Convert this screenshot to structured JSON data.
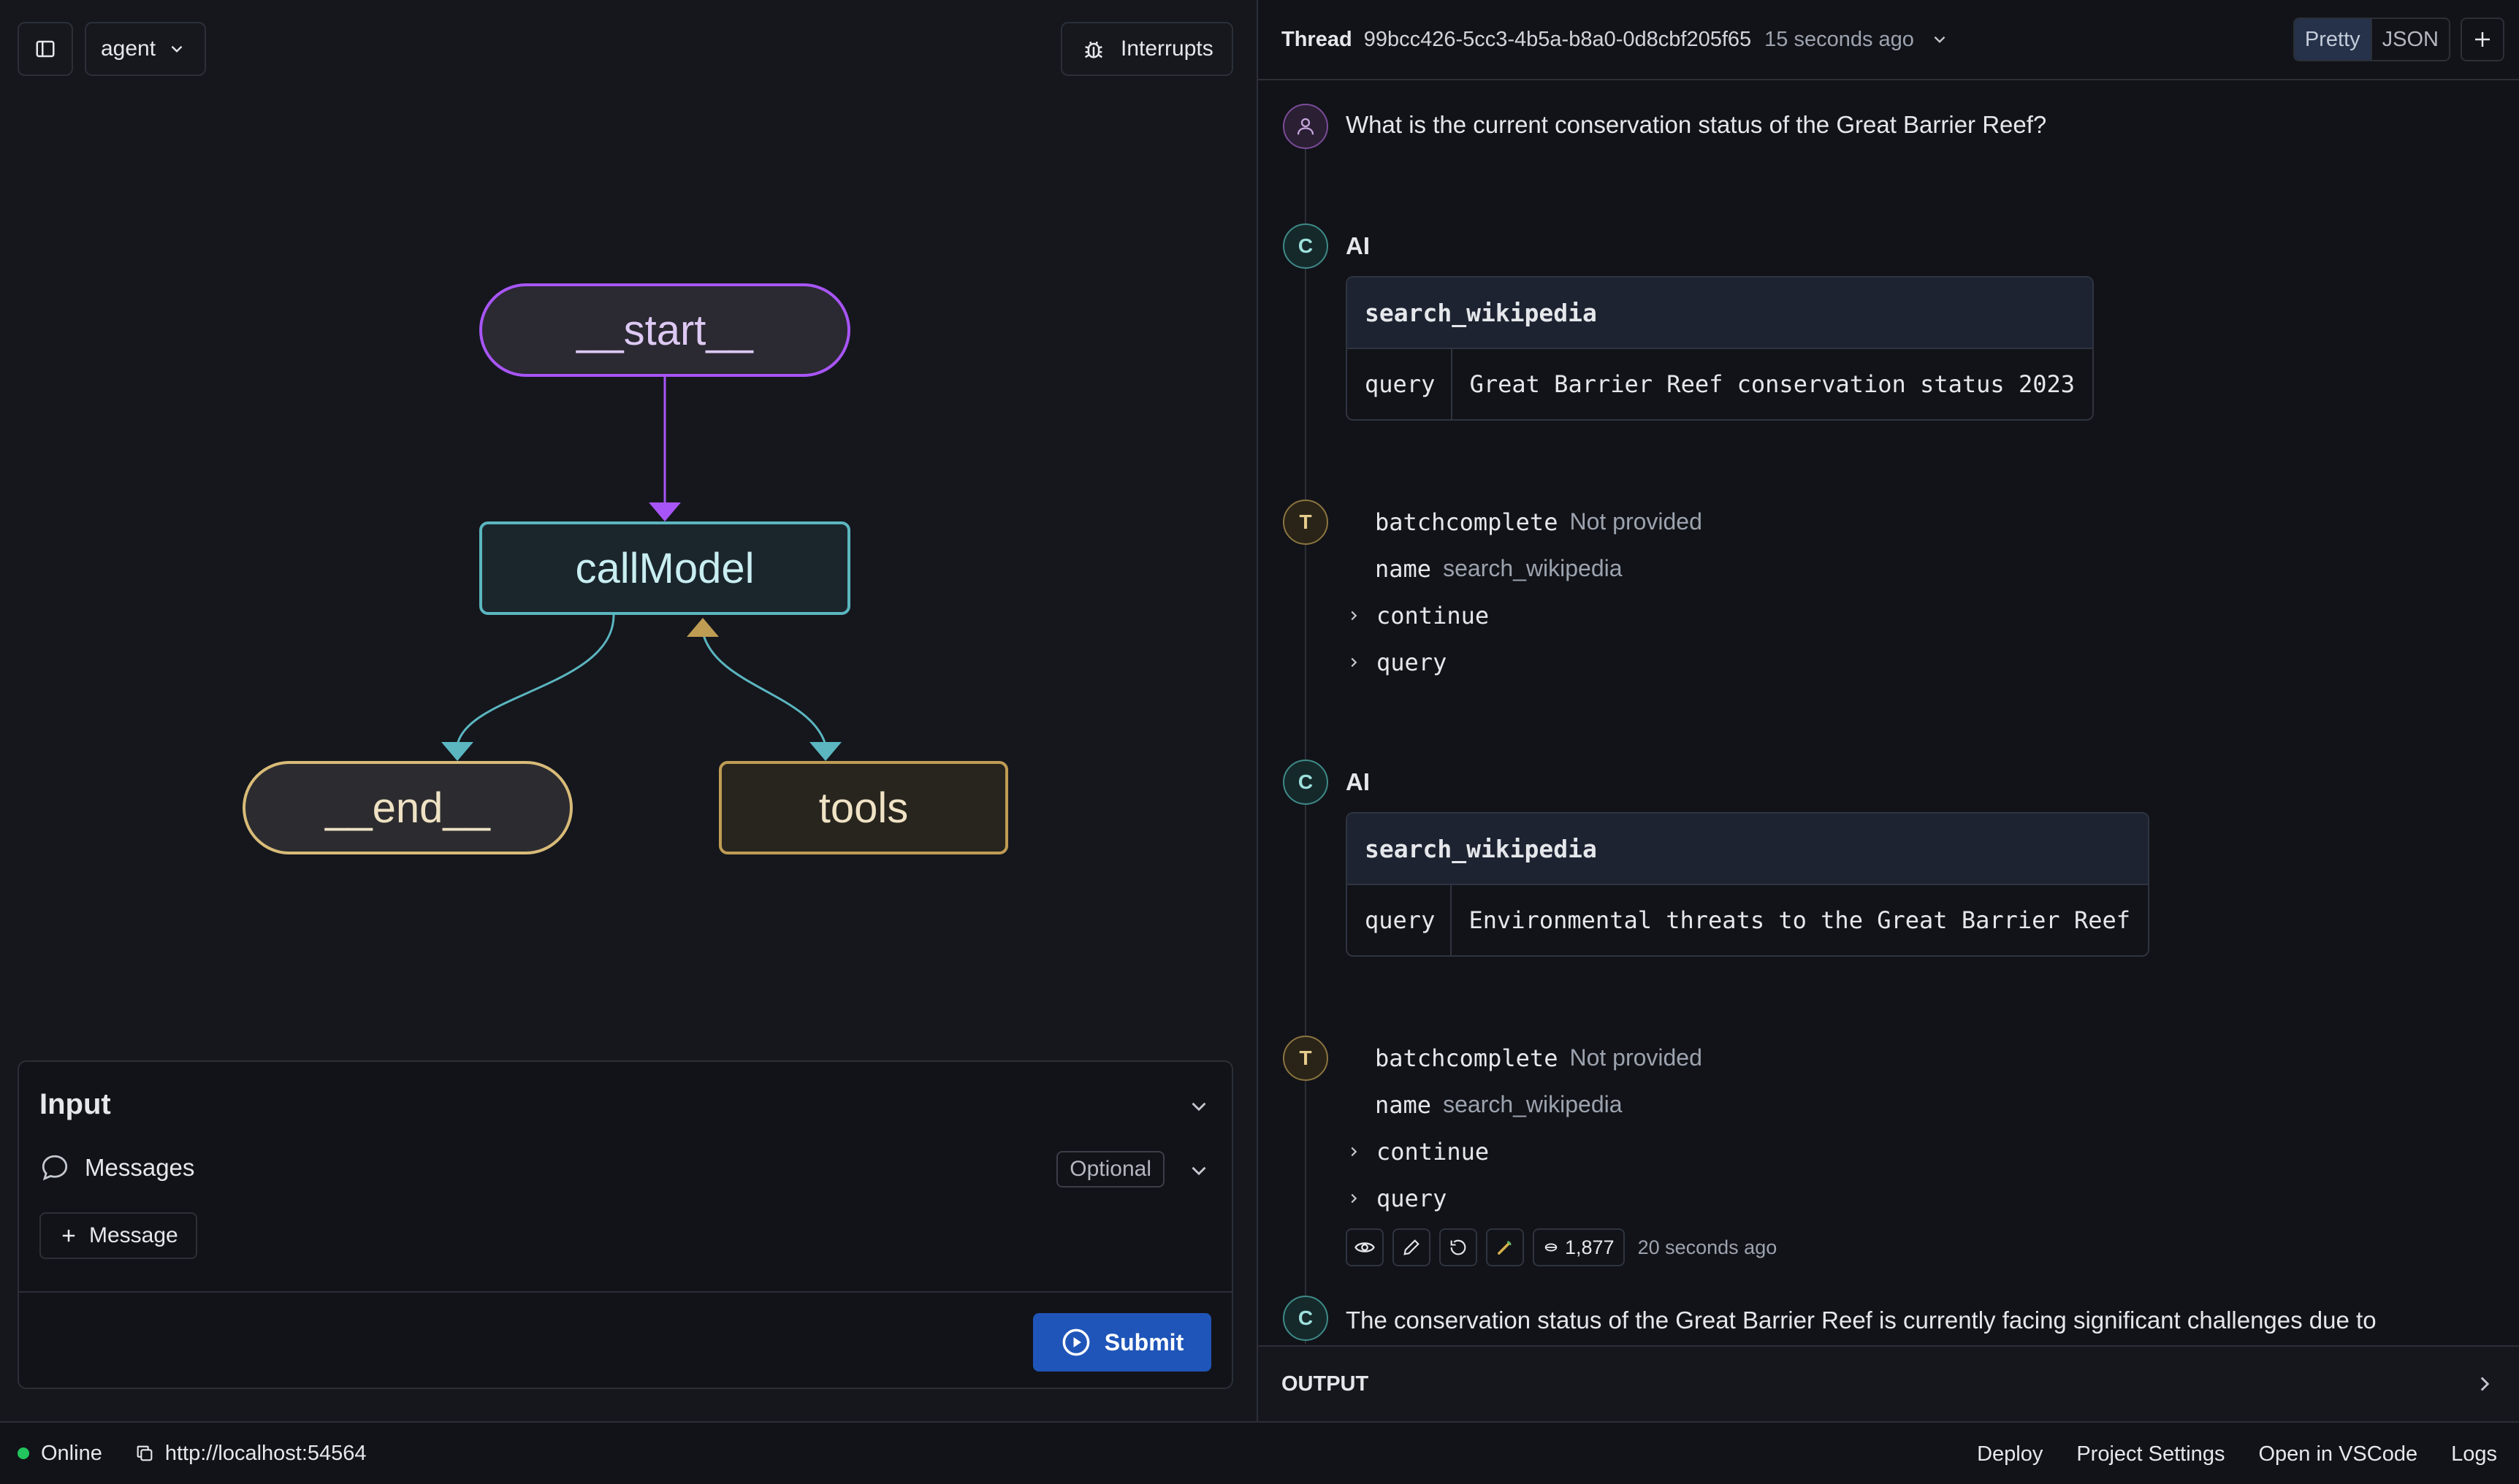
{
  "toolbar": {
    "agent_label": "agent",
    "interrupts_label": "Interrupts"
  },
  "graph": {
    "nodes": {
      "start": "__start__",
      "call_model": "callModel",
      "end": "__end__",
      "tools": "tools"
    }
  },
  "input": {
    "title": "Input",
    "messages_label": "Messages",
    "optional_badge": "Optional",
    "add_message_label": "Message",
    "submit_label": "Submit"
  },
  "thread": {
    "label": "Thread",
    "id": "99bcc426-5cc3-4b5a-b8a0-0d8cbf205f65",
    "time": "15 seconds ago",
    "view_modes": [
      "Pretty",
      "JSON"
    ],
    "active_view": "Pretty"
  },
  "messages": {
    "user_question": "What is the current conservation status of the Great Barrier Reef?",
    "ai_label": "AI",
    "avatar_c": "C",
    "avatar_t": "T",
    "tool_call_1": {
      "name": "search_wikipedia",
      "key": "query",
      "value": "Great Barrier Reef conservation status 2023"
    },
    "tool_result_1": {
      "batch_key": "batchcomplete",
      "batch_value": "Not provided",
      "name_key": "name",
      "name_value": "search_wikipedia",
      "expand_1": "continue",
      "expand_2": "query"
    },
    "tool_call_2": {
      "name": "search_wikipedia",
      "key": "query",
      "value": "Environmental threats to the Great Barrier Reef"
    },
    "tool_result_2": {
      "batch_key": "batchcomplete",
      "batch_value": "Not provided",
      "name_key": "name",
      "name_value": "search_wikipedia",
      "expand_1": "continue",
      "expand_2": "query"
    },
    "actions": {
      "token_count": "1,877",
      "time": "20 seconds ago"
    },
    "final_answer": "The conservation status of the Great Barrier Reef is currently facing significant challenges due to"
  },
  "output": {
    "label": "OUTPUT"
  },
  "footer": {
    "status": "Online",
    "url": "http://localhost:54564",
    "links": [
      "Deploy",
      "Project Settings",
      "Open in VSCode",
      "Logs"
    ]
  },
  "colors": {
    "start_node": "#a855f7",
    "call_model_node": "#5bb6c0",
    "end_node": "#d8bb78",
    "tools_node": "#bf9c53",
    "submit_button": "#1f55b8",
    "online_status": "#22c55e"
  }
}
